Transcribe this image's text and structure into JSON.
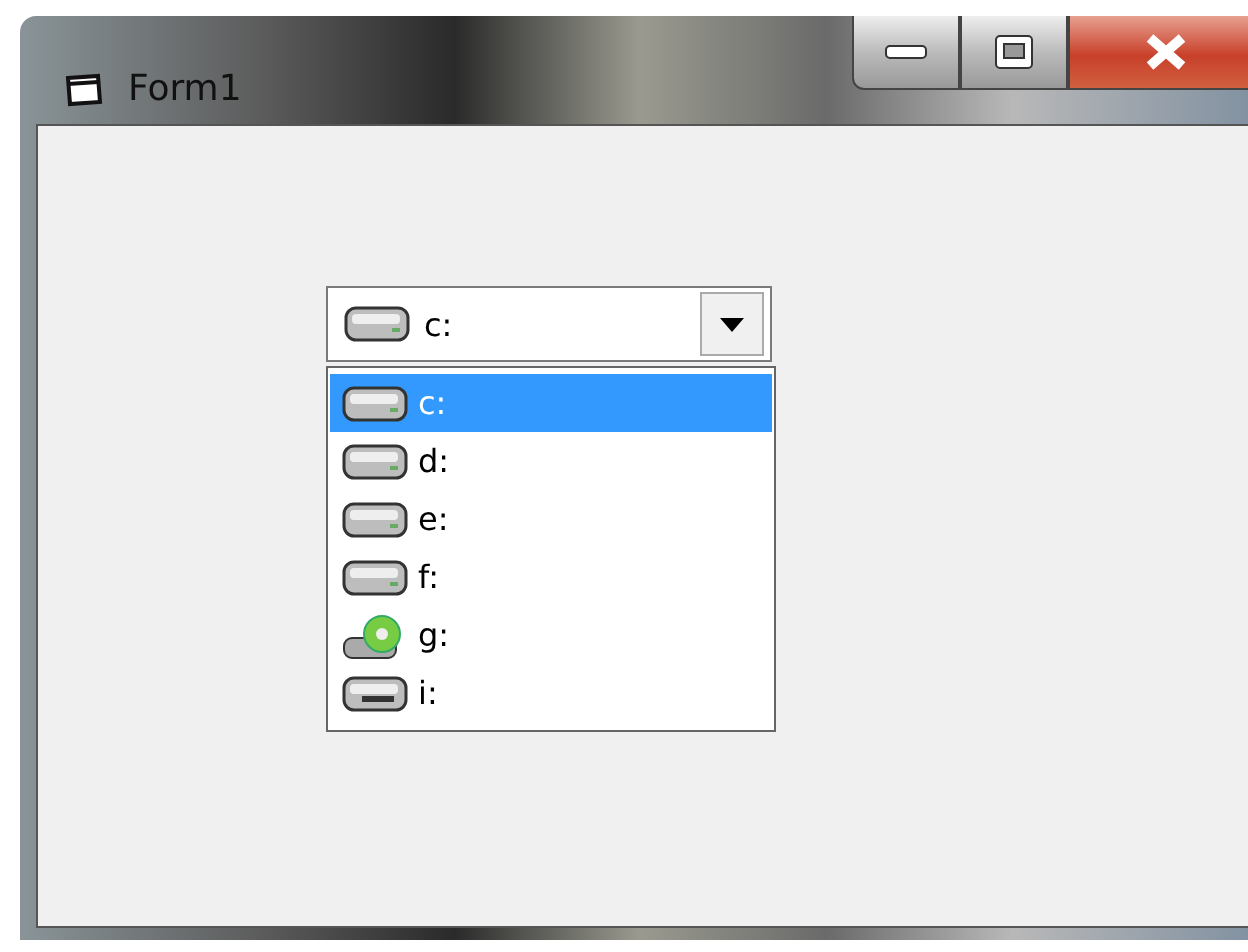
{
  "window": {
    "title": "Form1"
  },
  "drive_combo": {
    "value": {
      "label": "c:",
      "kind": "hdd"
    },
    "expanded": true,
    "items": [
      {
        "label": "c:",
        "kind": "hdd",
        "selected": true
      },
      {
        "label": "d:",
        "kind": "hdd",
        "selected": false
      },
      {
        "label": "e:",
        "kind": "hdd",
        "selected": false
      },
      {
        "label": "f:",
        "kind": "hdd",
        "selected": false
      },
      {
        "label": "g:",
        "kind": "cd",
        "selected": false
      },
      {
        "label": "i:",
        "kind": "removable",
        "selected": false
      }
    ]
  }
}
